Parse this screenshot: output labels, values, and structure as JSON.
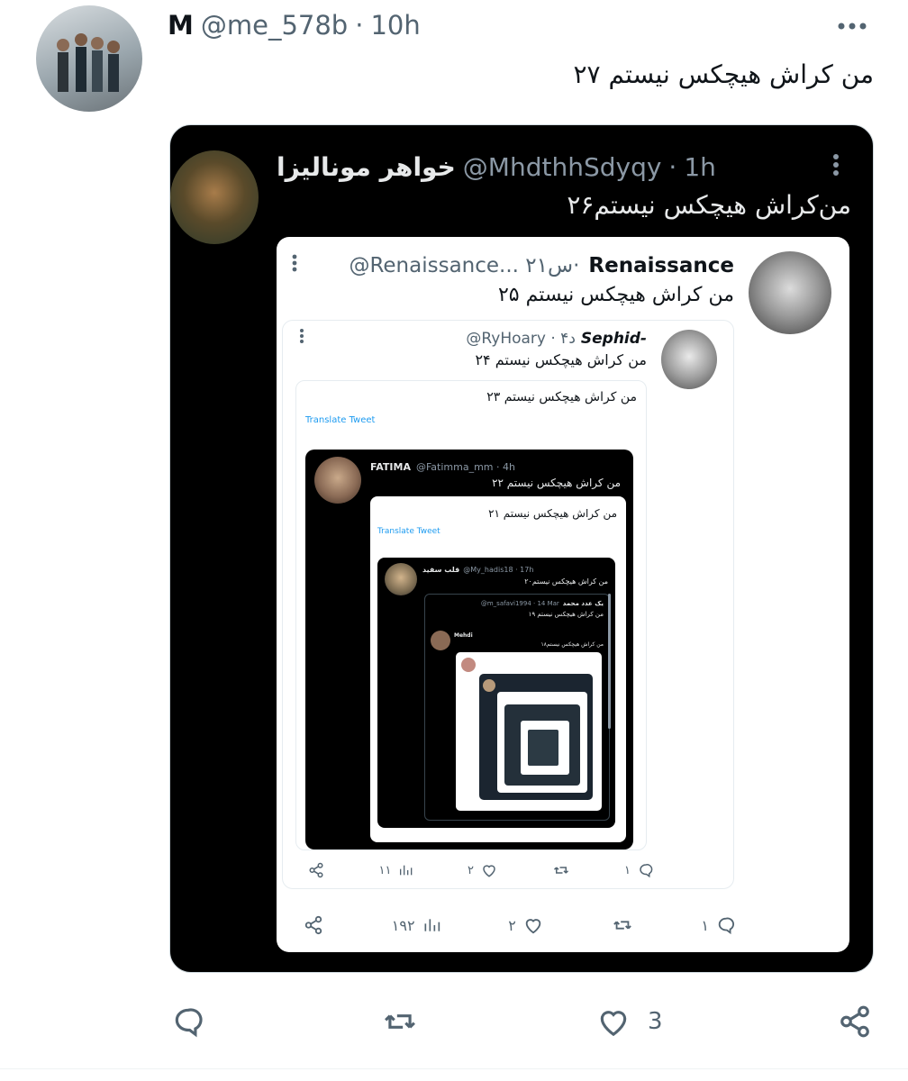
{
  "tweet": {
    "display_name": "M",
    "handle": "@me_578b",
    "separator": "·",
    "time": "10h",
    "text": "من کراش هیچکس نیستم ۲۷",
    "actions": {
      "likes": "3"
    }
  },
  "quote1": {
    "display_name": "خواهر مونالیزا",
    "handle": "@MhdthhSdyqy",
    "separator": "·",
    "time": "1h",
    "text": "من‌کراش هیچکس نیستم۲۶"
  },
  "quote2": {
    "display_name": "Renaissance",
    "handle_time": "@Renaissance... ۲۱س·",
    "text": "من کراش هیچکس نیستم ۲۵",
    "actions": {
      "replies": "۱",
      "likes": "۲",
      "views": "۱۹۲"
    }
  },
  "quote3": {
    "display_name": "Sephid-",
    "handle_time": "@RyHoary · ۴د",
    "text": "من کراش هیچکس نیستم ۲۴",
    "actions": {
      "replies": "۱",
      "likes": "۲",
      "views": "۱۱"
    }
  },
  "quote4": {
    "text": "من کراش هیچکس نیستم ۲۳",
    "translate": "Translate Tweet"
  },
  "quote5": {
    "display_name": "FATIMA",
    "handle_time": "@Fatimma_mm · 4h",
    "text": "من کراش هیچکس نیستم ۲۲"
  },
  "quote6": {
    "text": "من کراش هیچکس نیستم ۲۱",
    "translate": "Translate Tweet"
  },
  "quote7": {
    "display_name": "قلب سفید",
    "handle_time": "@My_hadis18 · 17h",
    "text": "من کراش هیچکس نیستم۲۰"
  },
  "quote8": {
    "display_name": "یک عدد محمد",
    "handle_time": "@m_safavi1994 · 14 Mar",
    "text": "من کراش هیچکس نیستم ۱۹"
  },
  "quote9": {
    "display_name": "Mehdi",
    "text": "من کراش هیچکس نیستم۱۸"
  },
  "colors": {
    "text": "#0f1419",
    "muted": "#536471",
    "dark_card": "#000000",
    "link": "#1d9bf0"
  }
}
